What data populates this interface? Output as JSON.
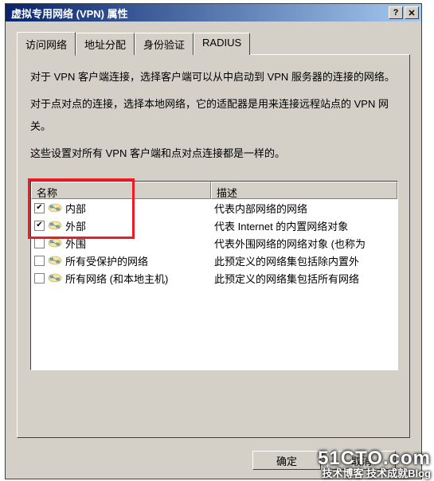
{
  "window": {
    "title": "虚拟专用网络 (VPN) 属性",
    "help_glyph": "?",
    "close_glyph": "✕"
  },
  "tabs": [
    {
      "label": "访问网络",
      "active": true
    },
    {
      "label": "地址分配",
      "active": false
    },
    {
      "label": "身份验证",
      "active": false
    },
    {
      "label": "RADIUS",
      "active": false
    }
  ],
  "instructions": [
    "对于 VPN 客户端连接，选择客户端可以从中启动到 VPN 服务器的连接的网络。",
    "对于点对点的连接，选择本地网络，它的适配器是用来连接远程站点的 VPN 网关。",
    "这些设置对所有 VPN 客户端和点对点连接都是一样的。"
  ],
  "columns": {
    "name": "名称",
    "desc": "描述"
  },
  "rows": [
    {
      "checked": true,
      "name": "内部",
      "desc": "代表内部网络的网络"
    },
    {
      "checked": true,
      "name": "外部",
      "desc": "代表 Internet 的内置网络对象"
    },
    {
      "checked": false,
      "name": "外围",
      "desc": "代表外围网络的网络对象 (也称为"
    },
    {
      "checked": false,
      "name": "所有受保护的网络",
      "desc": "此预定义的网络集包括除内置外"
    },
    {
      "checked": false,
      "name": "所有网络 (和本地主机)",
      "desc": "此预定义的网络集包括所有网络"
    }
  ],
  "buttons": {
    "ok": "确定",
    "cancel": "取消"
  },
  "watermark": {
    "line1": "51CTO.com",
    "line2": "技术博客 技术成就Blog"
  }
}
